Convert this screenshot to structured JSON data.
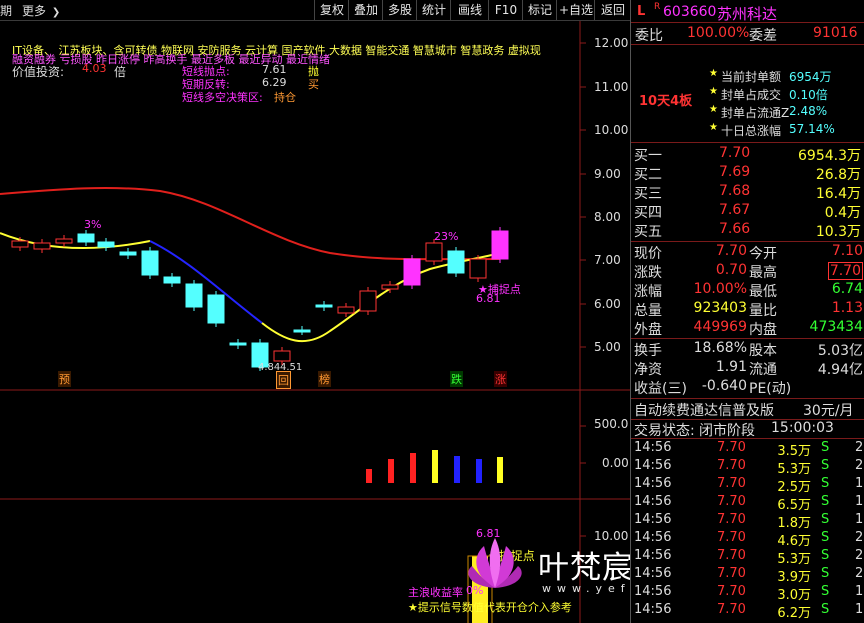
{
  "toolbar": {
    "left_title": "期",
    "more_label": "更多",
    "more_arrow": "❯",
    "buttons": [
      "复权",
      "叠加",
      "多股",
      "统计",
      "画线",
      "F10",
      "标记",
      "+自选",
      "返回"
    ]
  },
  "chart": {
    "y_ticks": [
      "12.00",
      "11.00",
      "10.00",
      "9.00",
      "8.00",
      "7.00",
      "6.00",
      "5.00"
    ],
    "vol_ticks": [
      "500.0",
      "0.00"
    ],
    "ind_ticks": [
      "10.00"
    ],
    "concepts_line1": "IT设备、 江苏板块、含可转债 物联网 安防服务 云计算 国产软件 大数据 智能交通 智慧城市 智慧政务 虚拟现",
    "concepts_line2": "融资融券 亏损股 昨日涨停 昨高换手 最近多板 最近异动 最近情绪",
    "value_label": "价值投资:",
    "value_number": "4.03",
    "value_unit": "倍",
    "short_throw_label": "短线抛点:",
    "short_throw_value": "7.61",
    "short_throw_tag": "抛",
    "short_rebound_label": "短期反转:",
    "short_rebound_value": "6.29",
    "short_rebound_tag": "买",
    "decision_label": "短线多空决策区:",
    "decision_value": "持仓",
    "pct_label_1": "3%",
    "pct_label_2": "23%",
    "catch_label": "捕捉点",
    "catch_value": "6.81",
    "low_label": "4.84",
    "low_label2": "4.51",
    "markers": [
      "预",
      "回",
      "榜",
      "跌",
      "涨"
    ],
    "ind_catch_value": "6.81",
    "ind_catch_label": "捕捉点",
    "main_wave_label": "主浪收益率",
    "main_wave_value": "0%",
    "hint_text": "★提示信号数值代表开仓介入参考",
    "watermark": "叶梵宸指标公式网",
    "watermark_url": "www.yefanchen.com"
  },
  "colors": {
    "up": "#ff3333",
    "down": "#54ffff",
    "ma_red": "#e0201c",
    "ma_yellow": "#ffff33",
    "ma_blue": "#2424ff",
    "magenta": "#ff33ff",
    "orange": "#ff9933"
  },
  "panel": {
    "code_prefix": "L",
    "code_r": "R",
    "code": "603660",
    "name": "苏州科达",
    "weibi_label": "委比",
    "weibi_value": "100.00%",
    "weicha_label": "委差",
    "weicha_value": "91016",
    "board_title": "10天4板",
    "board_items": [
      {
        "label": "当前封单额",
        "value": "6954万"
      },
      {
        "label": "封单占成交",
        "value": "0.10倍"
      },
      {
        "label": "封单占流通Z",
        "value": "2.48%"
      },
      {
        "label": "十日总涨幅",
        "value": "57.14%"
      }
    ],
    "bids": [
      {
        "label": "买一",
        "price": "7.70",
        "vol": "6954.3万"
      },
      {
        "label": "买二",
        "price": "7.69",
        "vol": "26.8万"
      },
      {
        "label": "买三",
        "price": "7.68",
        "vol": "16.4万"
      },
      {
        "label": "买四",
        "price": "7.67",
        "vol": "0.4万"
      },
      {
        "label": "买五",
        "price": "7.66",
        "vol": "10.3万"
      }
    ],
    "quote": [
      {
        "l1": "现价",
        "v1": "7.70",
        "l2": "今开",
        "v2": "7.10"
      },
      {
        "l1": "涨跌",
        "v1": "0.70",
        "l2": "最高",
        "v2": "7.70"
      },
      {
        "l1": "涨幅",
        "v1": "10.00%",
        "l2": "最低",
        "v2": "6.74"
      },
      {
        "l1": "总量",
        "v1": "923403",
        "l2": "量比",
        "v2": "1.13"
      },
      {
        "l1": "外盘",
        "v1": "449969",
        "l2": "内盘",
        "v2": "473434"
      }
    ],
    "fin": [
      {
        "l1": "换手",
        "v1": "18.68%",
        "l2": "股本",
        "v2": "5.03亿"
      },
      {
        "l1": "净资",
        "v1": "1.91",
        "l2": "流通",
        "v2": "4.94亿"
      },
      {
        "l1": "收益(三)",
        "v1": "-0.640",
        "l2": "PE(动)",
        "v2": ""
      }
    ],
    "ad_text": "自动续费通达信普及版",
    "ad_price": "30元/月",
    "status_label": "交易状态:",
    "status_value": "闭市阶段",
    "status_time": "15:00:03",
    "ticks": [
      {
        "time": "14:56",
        "price": "7.70",
        "vol": "3.5万",
        "bs": "S",
        "n": "2"
      },
      {
        "time": "14:56",
        "price": "7.70",
        "vol": "5.3万",
        "bs": "S",
        "n": "2"
      },
      {
        "time": "14:56",
        "price": "7.70",
        "vol": "2.5万",
        "bs": "S",
        "n": "1"
      },
      {
        "time": "14:56",
        "price": "7.70",
        "vol": "6.5万",
        "bs": "S",
        "n": "1"
      },
      {
        "time": "14:56",
        "price": "7.70",
        "vol": "1.8万",
        "bs": "S",
        "n": "1"
      },
      {
        "time": "14:56",
        "price": "7.70",
        "vol": "4.6万",
        "bs": "S",
        "n": "2"
      },
      {
        "time": "14:56",
        "price": "7.70",
        "vol": "5.3万",
        "bs": "S",
        "n": "2"
      },
      {
        "time": "14:56",
        "price": "7.70",
        "vol": "3.9万",
        "bs": "S",
        "n": "2"
      },
      {
        "time": "14:56",
        "price": "7.70",
        "vol": "3.0万",
        "bs": "S",
        "n": "1"
      },
      {
        "time": "14:56",
        "price": "7.70",
        "vol": "6.2万",
        "bs": "S",
        "n": "1"
      }
    ]
  }
}
